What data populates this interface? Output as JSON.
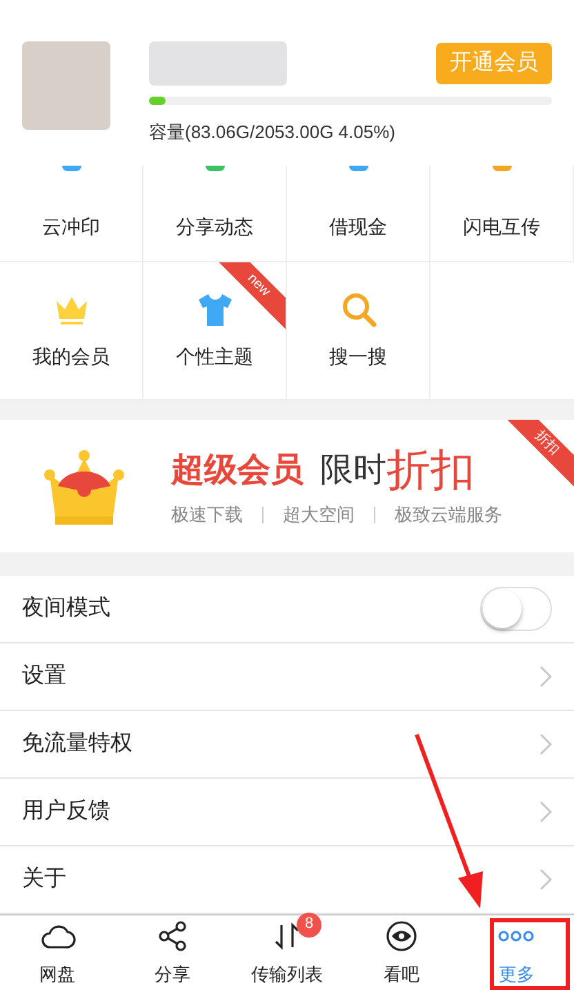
{
  "header": {
    "vip_button": "开通会员",
    "storage": {
      "level": 0.0405,
      "label": "容量(83.06G/2053.00G 4.05%)"
    }
  },
  "grid": [
    {
      "label": "云冲印",
      "kind": "print"
    },
    {
      "label": "分享动态",
      "kind": "share"
    },
    {
      "label": "借现金",
      "kind": "cash"
    },
    {
      "label": "闪电互传",
      "kind": "flash"
    },
    {
      "label": "我的会员",
      "kind": "crown"
    },
    {
      "label": "个性主题",
      "kind": "shirt",
      "ribbon": "new"
    },
    {
      "label": "搜一搜",
      "kind": "search"
    }
  ],
  "banner": {
    "title_bold": "超级会员",
    "title_mid": "限时",
    "title_accent": "折扣",
    "ribbon": "折扣",
    "features": [
      "极速下载",
      "超大空间",
      "极致云端服务"
    ]
  },
  "settings": [
    {
      "kind": "toggle",
      "label": "夜间模式",
      "on": false
    },
    {
      "kind": "link",
      "label": "设置"
    },
    {
      "kind": "link",
      "label": "免流量特权"
    },
    {
      "kind": "link",
      "label": "用户反馈"
    },
    {
      "kind": "link",
      "label": "关于"
    }
  ],
  "tab_bar": [
    {
      "label": "网盘",
      "kind": "cloud",
      "selected": false
    },
    {
      "label": "分享",
      "kind": "share",
      "selected": false
    },
    {
      "label": "传输列表",
      "kind": "transfer",
      "selected": false,
      "badge": "8"
    },
    {
      "label": "看吧",
      "kind": "eye",
      "selected": false
    },
    {
      "label": "更多",
      "kind": "more",
      "selected": true
    }
  ]
}
